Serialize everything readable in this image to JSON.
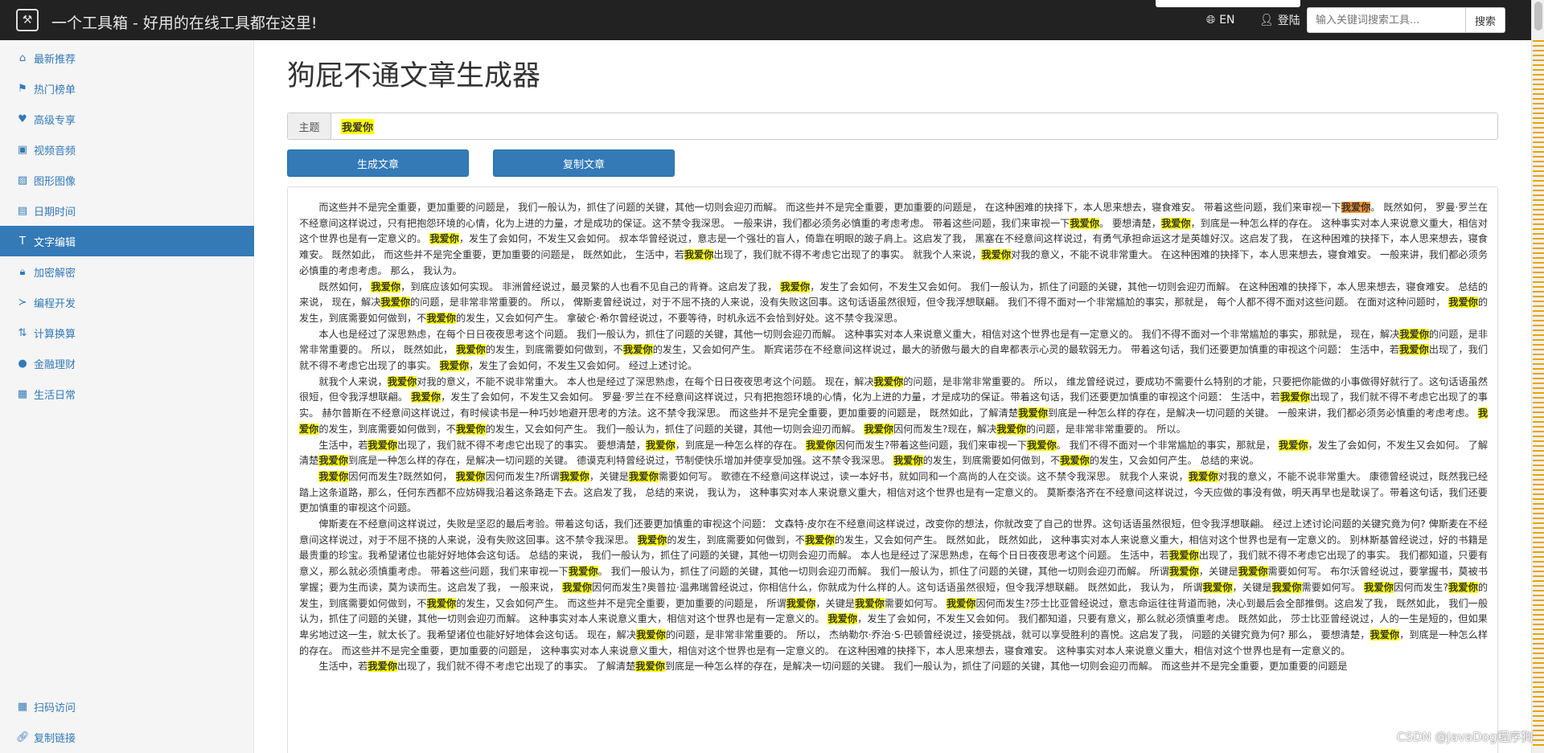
{
  "header": {
    "logo_icon": "toolbox-icon",
    "site_title": "一个工具箱 - 好用的在线工具都在这里!",
    "lang_label": "EN",
    "login_label": "登陆",
    "search_placeholder": "输入关键词搜索工具...",
    "search_button": "搜索"
  },
  "sidebar": {
    "items": [
      {
        "label": "最新推荐",
        "icon": "home-icon",
        "active": false
      },
      {
        "label": "热门榜单",
        "icon": "flag-icon",
        "active": false
      },
      {
        "label": "高级专享",
        "icon": "heart-icon",
        "active": false
      },
      {
        "label": "视频音频",
        "icon": "film-icon",
        "active": false
      },
      {
        "label": "图形图像",
        "icon": "picture-icon",
        "active": false
      },
      {
        "label": "日期时间",
        "icon": "calendar-icon",
        "active": false
      },
      {
        "label": "文字编辑",
        "icon": "text-icon",
        "active": true
      },
      {
        "label": "加密解密",
        "icon": "lock-icon",
        "active": false
      },
      {
        "label": "编程开发",
        "icon": "terminal-icon",
        "active": false
      },
      {
        "label": "计算换算",
        "icon": "sort-icon",
        "active": false
      },
      {
        "label": "金融理财",
        "icon": "piggy-bank-icon",
        "active": false
      },
      {
        "label": "生活日常",
        "icon": "qrcode-icon",
        "active": false
      }
    ],
    "bottom_items": [
      {
        "label": "扫码访问",
        "icon": "qrcode-icon"
      },
      {
        "label": "复制链接",
        "icon": "link-icon"
      }
    ]
  },
  "main": {
    "page_title": "狗屁不通文章生成器",
    "topic_label": "主题",
    "topic_value": "我爱你",
    "generate_button": "生成文章",
    "copy_button": "复制文章",
    "article_paragraphs": [
      "而这些并不是完全重要，更加重要的问题是， 我们一般认为，抓住了问题的关键，其他一切则会迎刃而解。 而这些并不是完全重要，更加重要的问题是， 在这种困难的抉择下，本人思来想去，寝食难安。 带着这些问题，我们来审视一下我爱你。 既然如何， 罗曼·罗兰在不经意间这样说过，只有把抱怨环境的心情，化为上进的力量，才是成功的保证。这不禁令我深思。 一般来讲，我们都必须务必慎重的考虑考虑。 带着这些问题，我们来审视一下我爱你。 要想清楚，我爱你，到底是一种怎么样的存在。 这种事实对本人来说意义重大，相信对这个世界也是有一定意义的。 我爱你，发生了会如何，不发生又会如何。 叔本华曾经说过，意志是一个强壮的盲人，倚靠在明眼的跛子肩上。这启发了我， 黑塞在不经意间这样说过，有勇气承担命运这才是英雄好汉。这启发了我， 在这种困难的抉择下，本人思来想去，寝食难安。 既然如此， 而这些并不是完全重要，更加重要的问题是， 既然如此， 生活中，若我爱你出现了，我们就不得不考虑它出现了的事实。 就我个人来说，我爱你对我的意义，不能不说非常重大。 在这种困难的抉择下，本人思来想去，寝食难安。 一般来讲，我们都必须务必慎重的考虑考虑。 那么， 我认为。",
      "既然如何， 我爱你，到底应该如何实现。 非洲曾经说过，最灵繁的人也看不见自己的背脊。这启发了我， 我爱你，发生了会如何，不发生又会如何。 我们一般认为，抓住了问题的关键，其他一切则会迎刃而解。 在这种困难的抉择下，本人思来想去，寝食难安。 总结的来说， 现在，解决我爱你的问题，是非常非常重要的。 所以， 俾斯麦曾经说过，对于不屈不挠的人来说，没有失败这回事。这句话语虽然很短，但令我浮想联翩。 我们不得不面对一个非常尴尬的事实，那就是， 每个人都不得不面对这些问题。 在面对这种问题时， 我爱你的发生，到底需要如何做到，不我爱你的发生，又会如何产生。 拿破仑·希尔曾经说过，不要等待，时机永远不会恰到好处。这不禁令我深思。",
      "本人也是经过了深思熟虑，在每个日日夜夜思考这个问题。 我们一般认为，抓住了问题的关键，其他一切则会迎刃而解。 这种事实对本人来说意义重大，相信对这个世界也是有一定意义的。 我们不得不面对一个非常尴尬的事实，那就是， 现在，解决我爱你的问题，是非常非常重要的。 所以， 既然如此， 我爱你的发生，到底需要如何做到，不我爱你的发生，又会如何产生。 斯宾诺莎在不经意间这样说过，最大的骄傲与最大的自卑都表示心灵的最软弱无力。 带着这句话，我们还要更加慎重的审视这个问题： 生活中，若我爱你出现了，我们就不得不考虑它出现了的事实。 我爱你，发生了会如何，不发生又会如何。 经过上述讨论。",
      "就我个人来说，我爱你对我的意义，不能不说非常重大。 本人也是经过了深思熟虑，在每个日日夜夜思考这个问题。 现在，解决我爱你的问题，是非常非常重要的。 所以， 维龙曾经说过，要成功不需要什么特别的才能，只要把你能做的小事做得好就行了。这句话语虽然很短，但令我浮想联翩。 我爱你，发生了会如何，不发生又会如何。 罗曼·罗兰在不经意间这样说过，只有把抱怨环境的心情，化为上进的力量，才是成功的保证。带着这句话，我们还要更加慎重的审视这个问题： 生活中，若我爱你出现了，我们就不得不考虑它出现了的事实。 赫尔普斯在不经意间这样说过，有时候读书是一种巧妙地避开思考的方法。这不禁令我深思。 而这些并不是完全重要，更加重要的问题是， 既然如此，了解清楚我爱你到底是一种怎么样的存在，是解决一切问题的关键。 一般来讲，我们都必须务必慎重的考虑考虑。 我爱你的发生，到底需要如何做到，不我爱你的发生，又会如何产生。 我们一般认为，抓住了问题的关键，其他一切则会迎刃而解。 我爱你因何而发生?现在，解决我爱你的问题，是非常非常重要的。 所以。",
      "生活中，若我爱你出现了，我们就不得不考虑它出现了的事实。 要想清楚，我爱你，到底是一种怎么样的存在。 我爱你因何而发生?带着这些问题，我们来审视一下我爱你。 我们不得不面对一个非常尴尬的事实，那就是， 我爱你，发生了会如何，不发生又会如何。 了解清楚我爱你到底是一种怎么样的存在，是解决一切问题的关键。 德谟克利特曾经说过，节制使快乐增加并使享受加强。这不禁令我深思。 我爱你的发生，到底需要如何做到，不我爱你的发生，又会如何产生。 总结的来说。",
      "我爱你因何而发生?既然如何， 我爱你因何而发生?所谓我爱你，关键是我爱你需要如何写。 歌德在不经意间这样说过，读一本好书，就如同和一个高尚的人在交谈。这不禁令我深思。 就我个人来说，我爱你对我的意义，不能不说非常重大。 康德曾经说过，既然我已经踏上这条道路，那么，任何东西都不应妨碍我沿着这条路走下去。这启发了我， 总结的来说， 我认为， 这种事实对本人来说意义重大，相信对这个世界也是有一定意义的。 莫斯泰洛齐在不经意间这样说过，今天应做的事没有做，明天再早也是耽误了。带着这句话，我们还要更加慎重的审视这个问题。",
      "俾斯麦在不经意间这样说过，失败是坚忍的最后考验。带着这句话，我们还要更加慎重的审视这个问题： 文森特·皮尔在不经意间这样说过，改变你的想法，你就改变了自己的世界。这句话语虽然很短，但令我浮想联翩。 经过上述讨论问题的关键究竟为何? 俾斯麦在不经意间这样说过，对于不屈不挠的人来说，没有失败这回事。这不禁令我深思。 我爱你的发生，到底需要如何做到，不我爱你的发生，又会如何产生。 既然如此， 既然如此， 这种事实对本人来说意义重大，相信对这个世界也是有一定意义的。 别林斯基曾经说过，好的书籍是最贵重的珍宝。我希望诸位也能好好地体会这句话。 总结的来说， 我们一般认为，抓住了问题的关键，其他一切则会迎刃而解。 本人也是经过了深思熟虑，在每个日日夜夜思考这个问题。 生活中，若我爱你出现了，我们就不得不考虑它出现了的事实。 我们都知道，只要有意义，那么就必须慎重考虑。 带着这些问题，我们来审视一下我爱你。 我们一般认为，抓住了问题的关键，其他一切则会迎刃而解。 我们一般认为，抓住了问题的关键，其他一切则会迎刃而解。 所谓我爱你，关键是我爱你需要如何写。 布尔沃曾经说过，要掌握书，莫被书掌握；要为生而读，莫为读而生。这启发了我， 一般来说， 我爱你因何而发生?奥普拉·温弗瑞曾经说过，你相信什么，你就成为什么样的人。这句话语虽然很短，但令我浮想联翩。 既然如此， 我认为， 所谓我爱你，关键是我爱你需要如何写。 我爱你因何而发生?我爱你的发生，到底需要如何做到，不我爱你的发生，又会如何产生。 而这些并不是完全重要，更加重要的问题是， 所谓我爱你，关键是我爱你需要如何写。 我爱你因何而发生?莎士比亚曾经说过，意志命运往往背道而驰，决心到最后会全部推倒。这启发了我， 既然如此， 我们一般认为，抓住了问题的关键，其他一切则会迎刃而解。 这种事实对本人来说意义重大，相信对这个世界也是有一定意义的。 我爱你，发生了会如何，不发生又会如何。 我们都知道，只要有意义，那么就必须慎重考虑。 既然如此， 莎士比亚曾经说过，人的一生是短的，但如果卑劣地过这一生，就太长了。我希望诸位也能好好地体会这句话。 现在，解决我爱你的问题，是非常非常重要的。 所以， 杰纳勒尔·乔治·S·巴顿曾经说过，接受挑战，就可以享受胜利的喜悦。这启发了我， 问题的关键究竟为何? 那么， 要想清楚，我爱你，到底是一种怎么样的存在。 而这些并不是完全重要，更加重要的问题是， 这种事实对本人来说意义重大，相信对这个世界也是有一定意义的。 在这种困难的抉择下，本人思来想去，寝食难安。 这种事实对本人来说意义重大，相信对这个世界也是有一定意义的。",
      "生活中，若我爱你出现了，我们就不得不考虑它出现了的事实。 了解清楚我爱你到底是一种怎么样的存在，是解决一切问题的关键。 我们一般认为，抓住了问题的关键，其他一切则会迎刃而解。 而这些并不是完全重要，更加重要的问题是"
    ]
  },
  "watermark": "CSDN @JavaDog程序狗",
  "colors": {
    "topbar": "#222222",
    "accent": "#337ab7",
    "highlight": "#ffff00",
    "current_highlight": "#ff9632"
  }
}
